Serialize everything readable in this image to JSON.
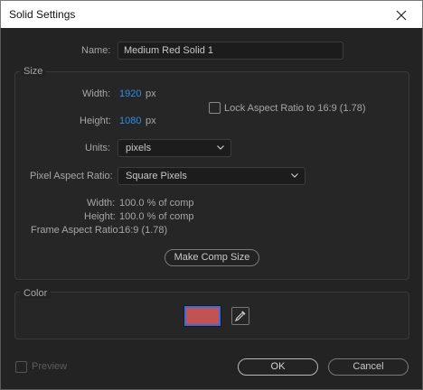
{
  "window": {
    "title": "Solid Settings"
  },
  "name": {
    "label": "Name:",
    "value": "Medium Red Solid 1"
  },
  "size": {
    "group_label": "Size",
    "width_label": "Width:",
    "width_value": "1920",
    "width_unit": "px",
    "height_label": "Height:",
    "height_value": "1080",
    "height_unit": "px",
    "lock_label": "Lock Aspect Ratio to 16:9 (1.78)",
    "lock_checked": false,
    "units_label": "Units:",
    "units_value": "pixels",
    "par_label": "Pixel Aspect Ratio:",
    "par_value": "Square Pixels",
    "info_width_label": "Width:",
    "info_width_value": "100.0 % of comp",
    "info_height_label": "Height:",
    "info_height_value": "100.0 % of comp",
    "info_far_label": "Frame Aspect Ratio:",
    "info_far_value": "16:9 (1.78)",
    "make_comp_size_label": "Make Comp Size"
  },
  "color": {
    "group_label": "Color",
    "swatch_color": "#c35252"
  },
  "footer": {
    "preview_label": "Preview",
    "ok_label": "OK",
    "cancel_label": "Cancel"
  },
  "icons": {
    "close": "close-icon",
    "chevron": "chevron-down-icon",
    "eyedropper": "eyedropper-icon"
  },
  "colors": {
    "accent": "#2d8ceb",
    "background": "#232323",
    "swatch_border": "#3f6ad8"
  }
}
